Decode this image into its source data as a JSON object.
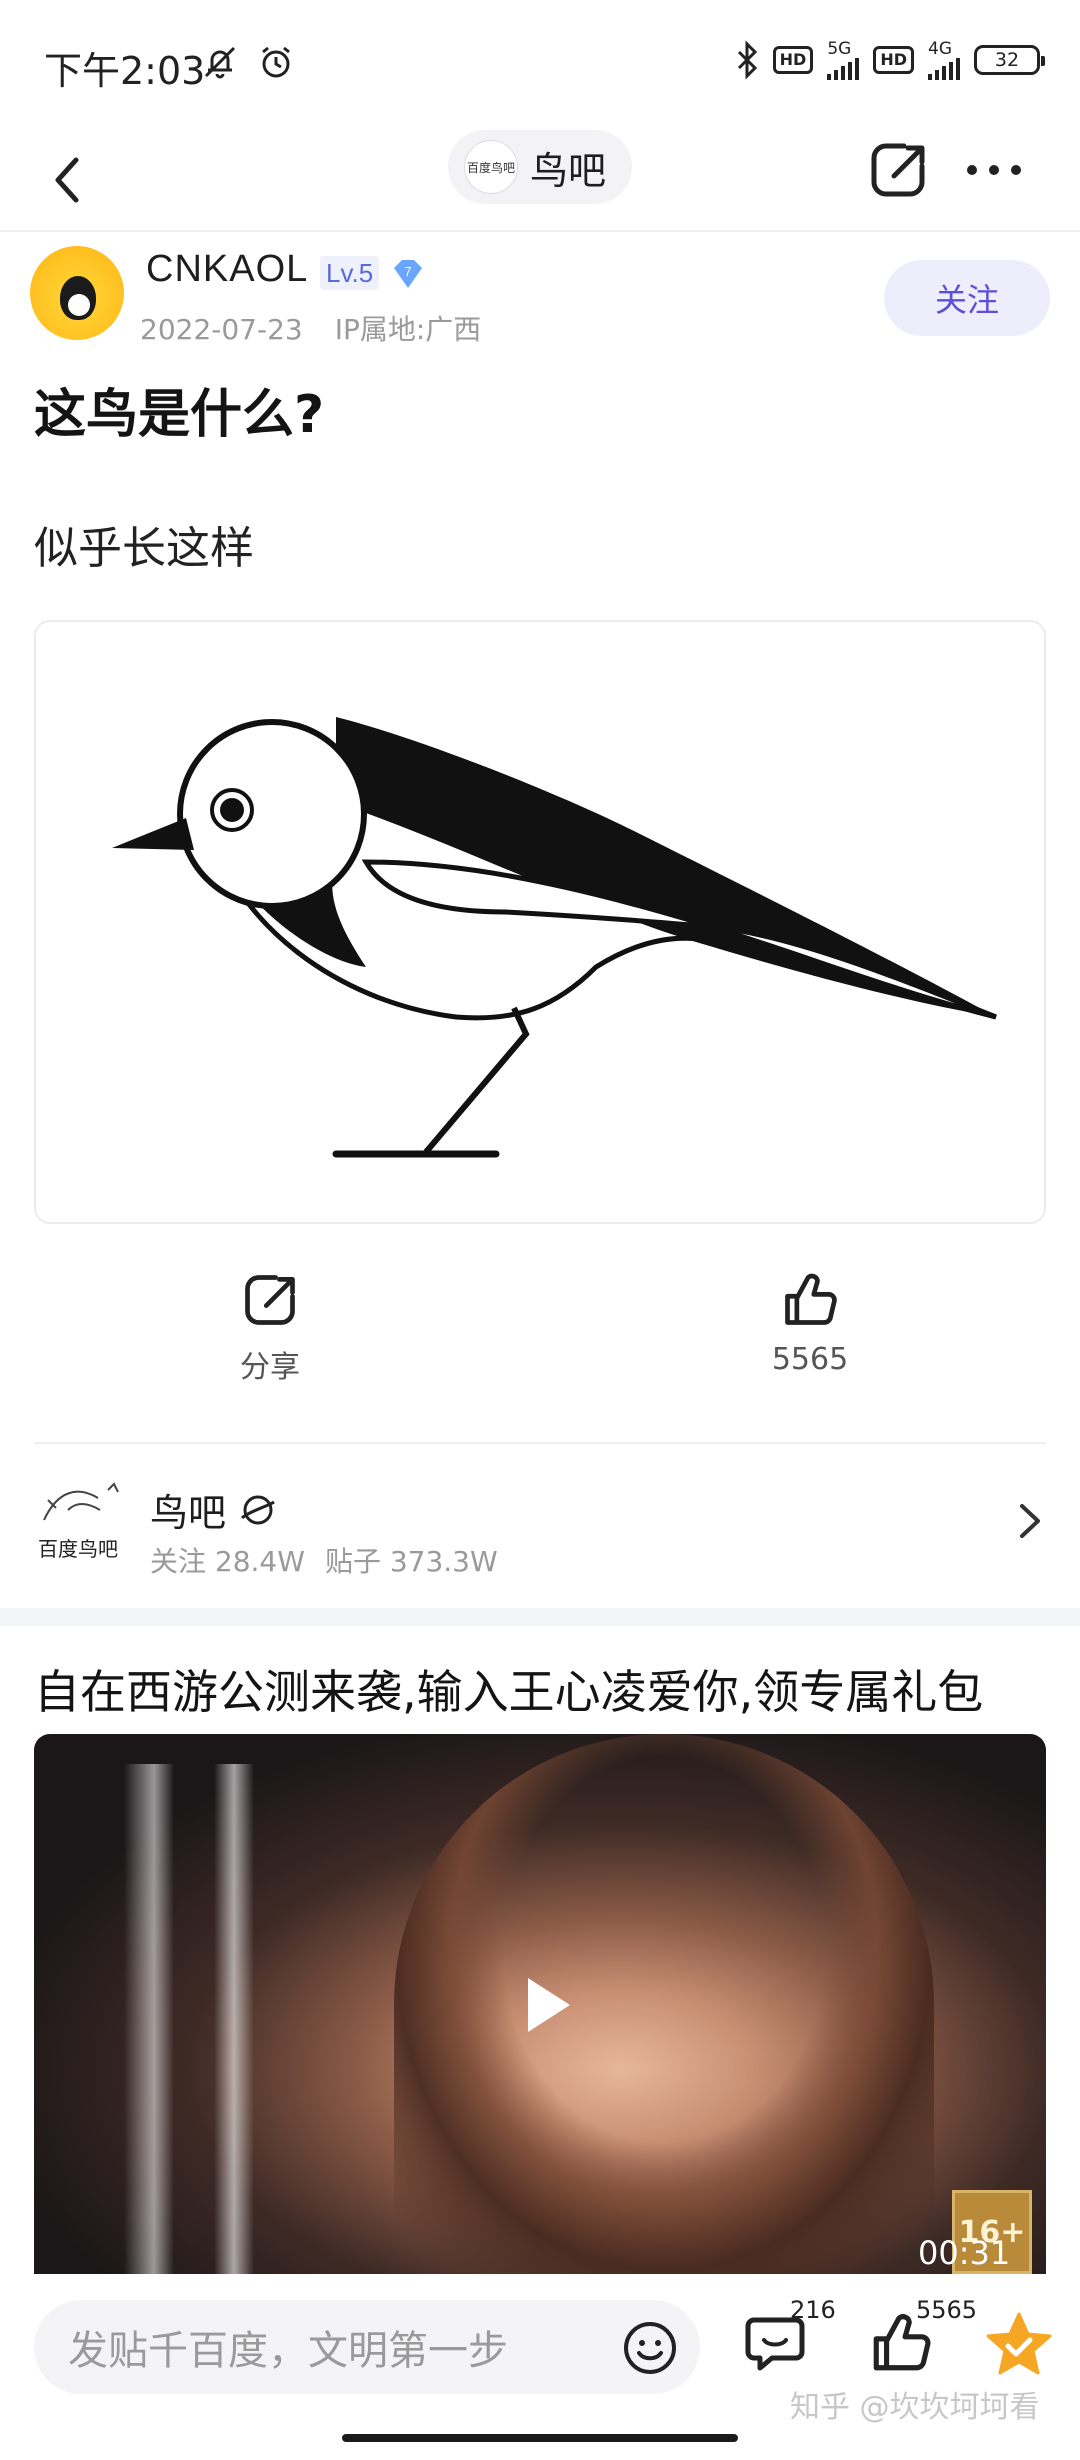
{
  "status_bar": {
    "time": "下午2:03",
    "net1": "5G",
    "net2": "4G",
    "hd": "HD",
    "battery": "32"
  },
  "nav": {
    "forum_name": "鸟吧",
    "logo_text": "百度鸟吧"
  },
  "post": {
    "author": "CNKAOL",
    "level": "Lv.5",
    "badge_number": "7",
    "date": "2022-07-23",
    "ip": "IP属地:广西",
    "follow_label": "关注",
    "title": "这鸟是什么?",
    "body": "似乎长这样"
  },
  "actions": {
    "share_label": "分享",
    "like_count": "5565"
  },
  "forum_card": {
    "name": "鸟吧",
    "followers": "关注 28.4W",
    "posts": "贴子 373.3W",
    "logo_text": "百度鸟吧"
  },
  "ad": {
    "title": "自在西游公测来袭,输入王心凌爱你,领专属礼包",
    "rating": "16+",
    "duration": "00:31"
  },
  "bottom_bar": {
    "compose_placeholder": "发贴千百度，文明第一步",
    "comment_count": "216",
    "like_count": "5565"
  },
  "watermark": "知乎 @坎坎坷坷看",
  "colors": {
    "accent": "#5c4fd6",
    "follow_bg": "#eeedfb",
    "star": "#f5a623"
  }
}
